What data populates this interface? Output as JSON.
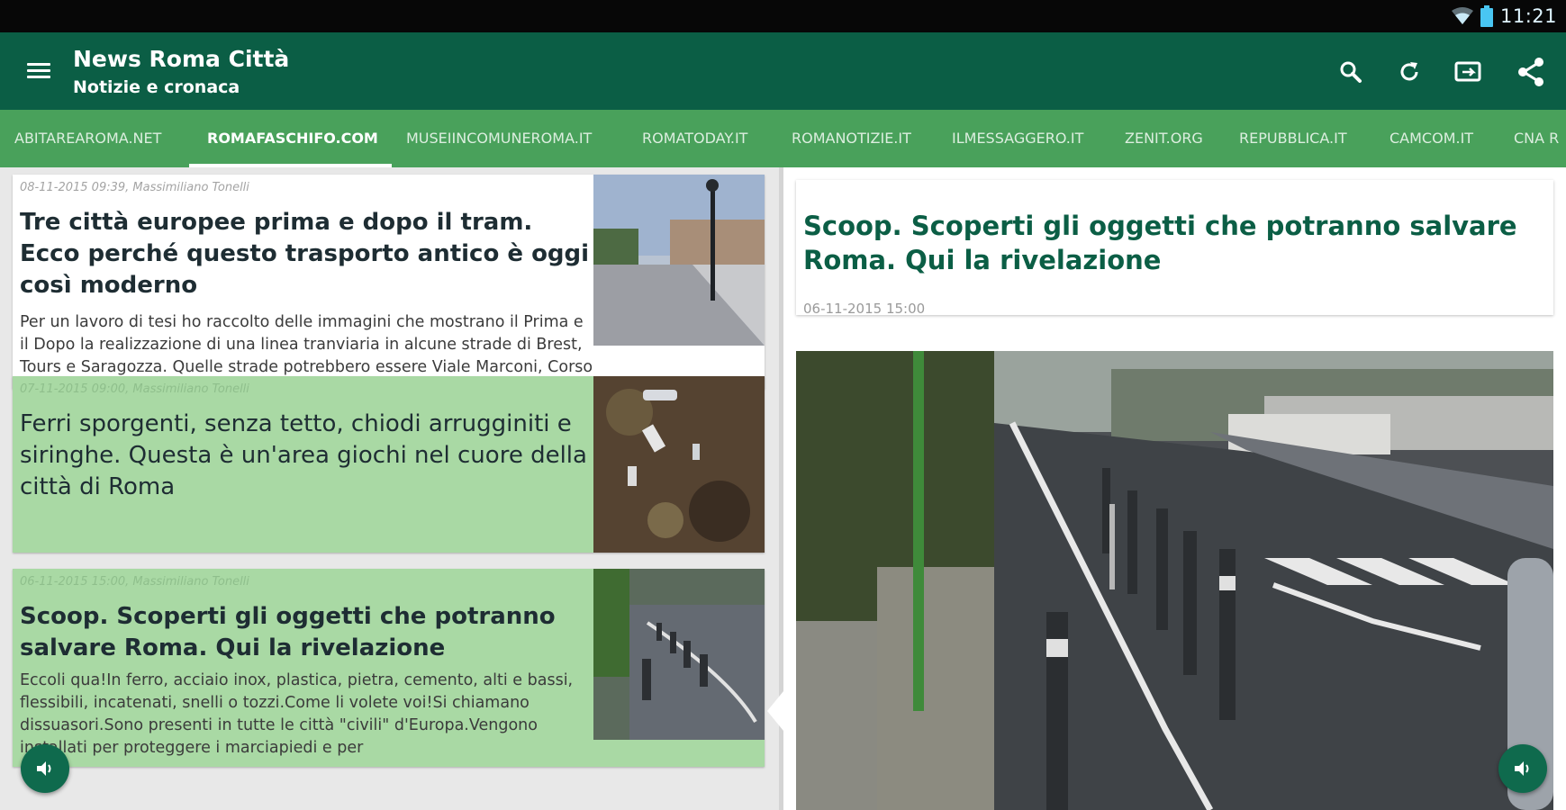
{
  "status_bar": {
    "time": "11:21",
    "icons": [
      "wifi-icon",
      "battery-icon"
    ]
  },
  "app_bar": {
    "title": "News Roma Città",
    "subtitle": "Notizie e cronaca",
    "actions": [
      "search-icon",
      "refresh-icon",
      "cast-icon",
      "share-icon"
    ]
  },
  "tabs": [
    "ABITAREAROMA.NET",
    "ROMAFASCHIFO.COM",
    "MUSEIINCOMUNEROMA.IT",
    "ROMATODAY.IT",
    "ROMANOTIZIE.IT",
    "ILMESSAGGERO.IT",
    "ZENIT.ORG",
    "REPUBBLICA.IT",
    "CAMCOM.IT",
    "CNA R"
  ],
  "active_tab": "ROMAFASCHIFO.COM",
  "articles": [
    {
      "meta": "08-11-2015 09:39, Massimiliano Tonelli",
      "title": "Tre città europee prima e dopo il tram. Ecco perché questo trasporto antico è oggi così moderno",
      "snippet": "Per un lavoro di tesi ho raccolto delle immagini che mostrano il Prima e il Dopo la realizzazione di una linea tranviaria in alcune strade di Brest, Tours e Saragozza. Quelle strade potrebbero essere Viale Marconi, Corso Vittorio Emanuele, Via del Corso, Via"
    },
    {
      "meta": "07-11-2015 09:00, Massimiliano Tonelli",
      "title": "Ferri sporgenti, senza tetto, chiodi arrugginiti e siringhe. Questa è un'area giochi nel cuore della città di Roma",
      "snippet": ""
    },
    {
      "meta": "06-11-2015 15:00, Massimiliano Tonelli",
      "title": "Scoop. Scoperti gli oggetti che potranno salvare Roma. Qui la rivelazione",
      "snippet": "Eccoli qua!In ferro, acciaio inox, plastica, pietra, cemento, alti e bassi, flessibili, incatenati, snelli o tozzi.Come li volete voi!Si chiamano dissuasori.Sono presenti in tutte le città \"civili\" d'Europa.Vengono installati per proteggere i marciapiedi e per"
    }
  ],
  "detail": {
    "title": "Scoop. Scoperti gli oggetti che potranno salvare Roma. Qui la rivelazione",
    "date": "06-11-2015 15:00"
  },
  "fab_icon": "volume-icon",
  "colors": {
    "primary": "#0b5e45",
    "tabs": "#49a15b",
    "read_card": "#a9d9a4"
  }
}
